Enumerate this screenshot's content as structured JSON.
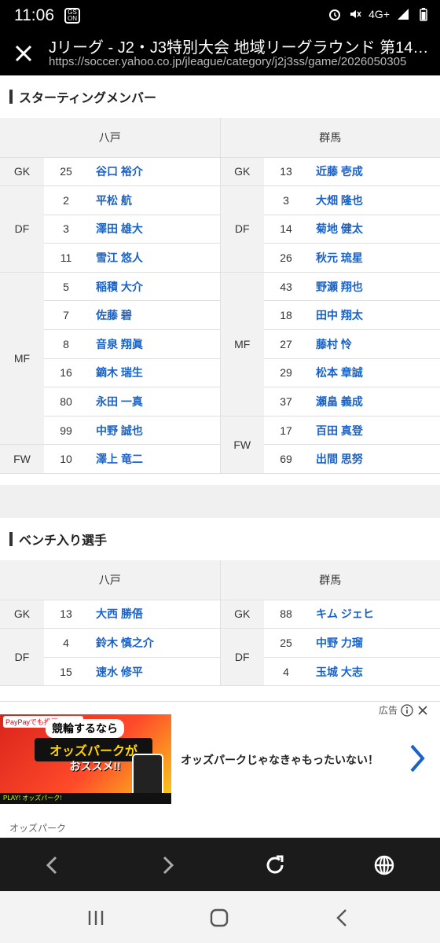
{
  "status_bar": {
    "time": "11:06",
    "network": "4G+"
  },
  "header": {
    "title": "Jリーグ - J2・J3特別大会 地域リーグラウンド 第14節 …",
    "url": "https://soccer.yahoo.co.jp/jleague/category/j2j3ss/game/2026050305"
  },
  "starting": {
    "title": "スターティングメンバー",
    "home_team": "八戸",
    "away_team": "群馬",
    "home": [
      {
        "pos": "GK",
        "num": "25",
        "name": "谷口 裕介"
      },
      {
        "pos": "DF",
        "num": "2",
        "name": "平松 航"
      },
      {
        "pos": "",
        "num": "3",
        "name": "澤田 雄大"
      },
      {
        "pos": "",
        "num": "11",
        "name": "雪江 悠人"
      },
      {
        "pos": "MF",
        "num": "5",
        "name": "稲積 大介"
      },
      {
        "pos": "",
        "num": "7",
        "name": "佐藤 碧"
      },
      {
        "pos": "",
        "num": "8",
        "name": "音泉 翔眞"
      },
      {
        "pos": "",
        "num": "16",
        "name": "鏑木 瑞生"
      },
      {
        "pos": "",
        "num": "80",
        "name": "永田 一真"
      },
      {
        "pos": "",
        "num": "99",
        "name": "中野 誠也"
      },
      {
        "pos": "FW",
        "num": "10",
        "name": "澤上 竜二"
      }
    ],
    "away": [
      {
        "pos": "GK",
        "num": "13",
        "name": "近藤 壱成"
      },
      {
        "pos": "DF",
        "num": "3",
        "name": "大畑 隆也"
      },
      {
        "pos": "",
        "num": "14",
        "name": "菊地 健太"
      },
      {
        "pos": "",
        "num": "26",
        "name": "秋元 琉星"
      },
      {
        "pos": "MF",
        "num": "43",
        "name": "野瀬 翔也"
      },
      {
        "pos": "",
        "num": "18",
        "name": "田中 翔太"
      },
      {
        "pos": "",
        "num": "27",
        "name": "藤村 怜"
      },
      {
        "pos": "",
        "num": "29",
        "name": "松本 章誠"
      },
      {
        "pos": "",
        "num": "37",
        "name": "瀬畠 義成"
      },
      {
        "pos": "FW",
        "num": "17",
        "name": "百田 真登"
      },
      {
        "pos": "",
        "num": "69",
        "name": "出間 思努"
      }
    ]
  },
  "bench": {
    "title": "ベンチ入り選手",
    "home_team": "八戸",
    "away_team": "群馬",
    "home": [
      {
        "pos": "GK",
        "num": "13",
        "name": "大西 勝俉"
      },
      {
        "pos": "DF",
        "num": "4",
        "name": "鈴木 慎之介"
      },
      {
        "pos": "",
        "num": "15",
        "name": "速水 修平"
      }
    ],
    "away": [
      {
        "pos": "GK",
        "num": "88",
        "name": "キム ジェヒ"
      },
      {
        "pos": "DF",
        "num": "25",
        "name": "中野 力瑠"
      },
      {
        "pos": "",
        "num": "4",
        "name": "玉城 大志"
      }
    ]
  },
  "ad": {
    "label": "広告",
    "banner_line1": "競輪するなら",
    "banner_line2": "オッズパークが",
    "banner_line3": "おススメ!!",
    "banner_badge": "PayPayでも投票できる!",
    "banner_footer": "PLAY! オッズパーク!",
    "text": "オッズパークじゃなきゃもったいない！",
    "sponsor": "オッズパーク"
  }
}
